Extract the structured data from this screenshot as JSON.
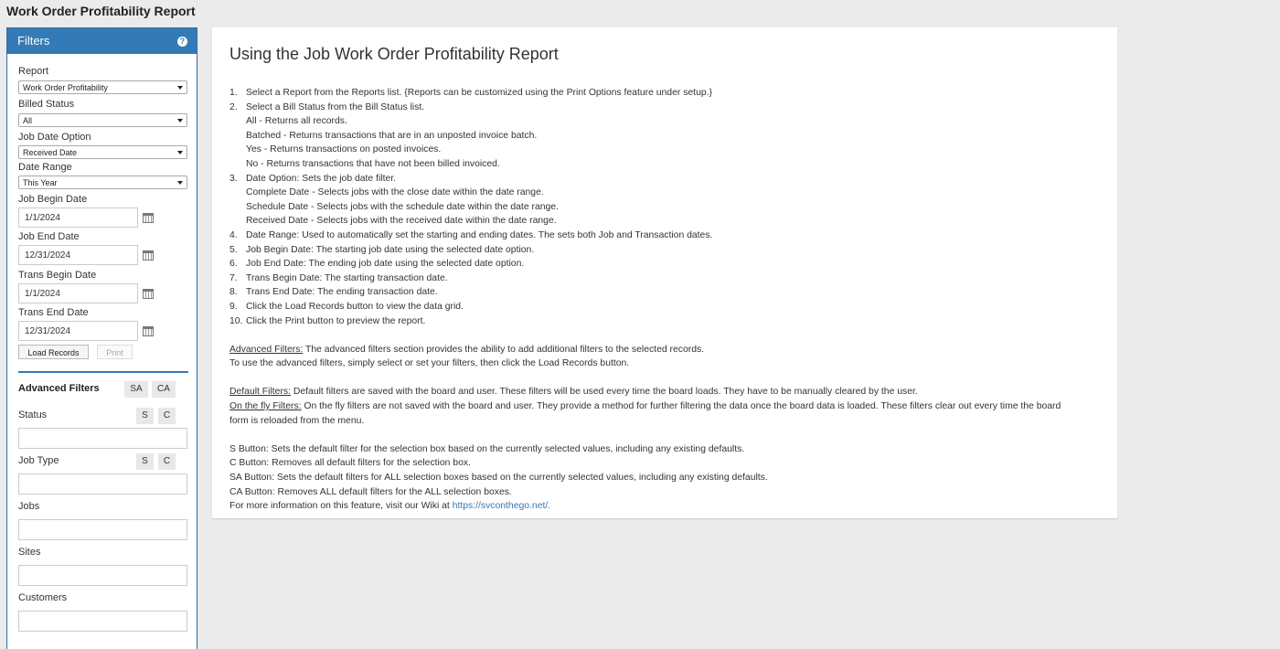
{
  "page": {
    "title": "Work Order Profitability Report"
  },
  "filters": {
    "header": "Filters",
    "help_icon": "?",
    "report": {
      "label": "Report",
      "value": "Work Order Profitability"
    },
    "billed_status": {
      "label": "Billed Status",
      "value": "All"
    },
    "job_date_option": {
      "label": "Job Date Option",
      "value": "Received Date"
    },
    "date_range": {
      "label": "Date Range",
      "value": "This Year"
    },
    "job_begin": {
      "label": "Job Begin Date",
      "value": "1/1/2024"
    },
    "job_end": {
      "label": "Job End Date",
      "value": "12/31/2024"
    },
    "trans_begin": {
      "label": "Trans Begin Date",
      "value": "1/1/2024"
    },
    "trans_end": {
      "label": "Trans End Date",
      "value": "12/31/2024"
    },
    "load_records": "Load Records",
    "print": "Print"
  },
  "advanced": {
    "title": "Advanced Filters",
    "sa": "SA",
    "ca": "CA",
    "s": "S",
    "c": "C",
    "status": "Status",
    "job_type": "Job Type",
    "jobs": "Jobs",
    "sites": "Sites",
    "customers": "Customers"
  },
  "help": {
    "title": "Using the Job Work Order Profitability Report",
    "steps": [
      {
        "n": "1.",
        "t": "Select a Report from the Reports list. {Reports can be customized using the Print Options feature under setup.}"
      },
      {
        "n": "2.",
        "t": "Select a Bill Status from the Bill Status list."
      },
      {
        "sub": "All - Returns all records."
      },
      {
        "sub": "Batched - Returns transactions that are in an unposted invoice batch."
      },
      {
        "sub": "Yes - Returns transactions on posted invoices."
      },
      {
        "sub": "No - Returns transactions that have not been billed invoiced."
      },
      {
        "n": "3.",
        "t": "Date Option:  Sets the job date filter."
      },
      {
        "sub": "Complete Date - Selects jobs with the close date within the date range."
      },
      {
        "sub": "Schedule Date - Selects jobs with the schedule date within the date range."
      },
      {
        "sub": "Received Date - Selects jobs with the received date within the date range."
      },
      {
        "n": "4.",
        "t": "Date Range: Used to automatically set the starting and ending dates. The sets both Job and Transaction dates."
      },
      {
        "n": "5.",
        "t": "Job Begin Date:  The starting job date using the selected date option."
      },
      {
        "n": "6.",
        "t": "Job End Date:  The ending job date using the selected date option."
      },
      {
        "n": "7.",
        "t": "Trans Begin Date:  The starting transaction date."
      },
      {
        "n": "8.",
        "t": "Trans End Date:  The ending transaction date."
      },
      {
        "n": "9.",
        "t": "Click the Load Records button to view the data grid."
      },
      {
        "n": "10.",
        "t": "Click the Print button to preview the report."
      }
    ],
    "adv_label": "Advanced Filters:",
    "adv_text": " The advanced filters section provides the ability to add additional filters to the selected records.",
    "adv_text2": "To use the advanced filters, simply select or set your filters, then click the Load Records button.",
    "default_label": "Default Filters:",
    "default_text": " Default filters are saved with the board and user. These filters will be used every time the board loads. They have to be manually cleared by the user.",
    "fly_label": "On the fly Filters:",
    "fly_text": " On the fly filters are not saved with the board and user. They provide a method for further filtering the data once the board data is loaded. These filters clear out every time the board",
    "fly_text2": "form is reloaded from the menu.",
    "s_button": "S Button: Sets the default filter for the selection box based on the currently selected values, including any existing defaults.",
    "c_button": "C Button: Removes all default filters for the selection box.",
    "sa_button": "SA Button: Sets the default filters for ALL selection boxes based on the currently selected values, including any existing defaults.",
    "ca_button": "CA Button: Removes ALL default filters for the ALL selection boxes.",
    "wiki_text": "For more information on this feature, visit our Wiki at ",
    "wiki_link": "https://svconthego.net/."
  }
}
